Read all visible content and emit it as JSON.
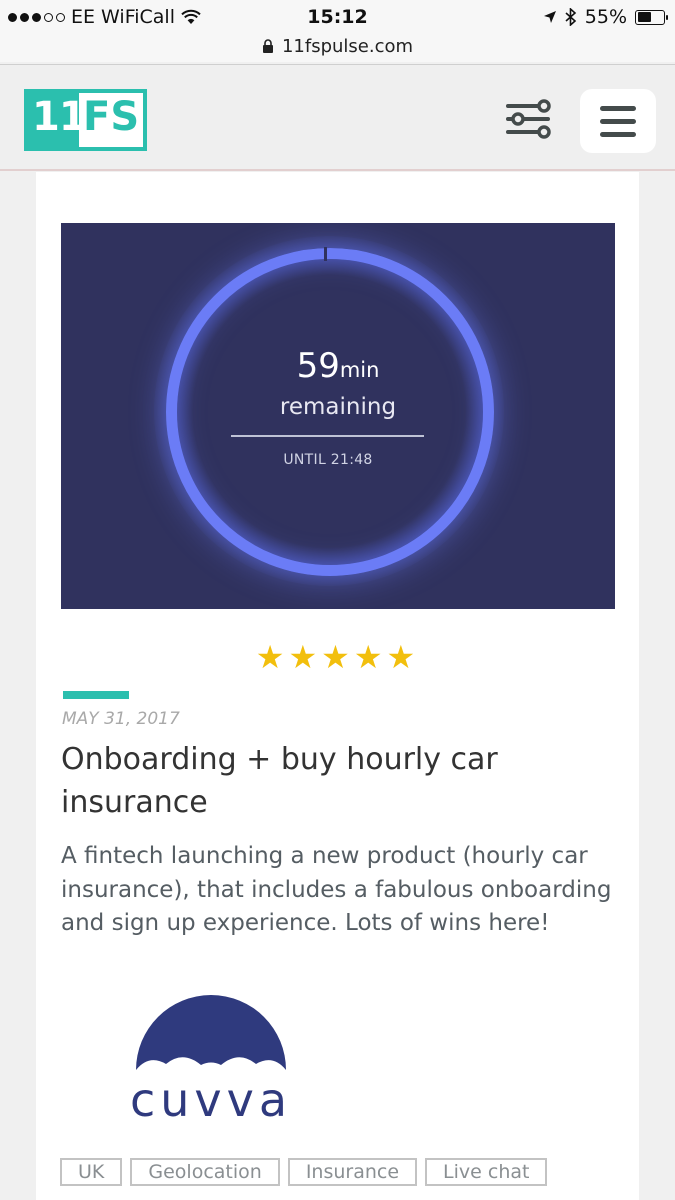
{
  "status_bar": {
    "carrier": "EE WiFiCall",
    "time": "15:12",
    "battery_percent": "55%",
    "battery_level": 0.55
  },
  "browser": {
    "url": "11fspulse.com"
  },
  "header": {
    "logo_number": "11",
    "logo_letters": "FS",
    "brand_color": "#2bbfae",
    "filter_icon": "sliders-icon",
    "menu_icon": "hamburger-menu-icon"
  },
  "article": {
    "hero": {
      "minutes": "59",
      "minutes_unit": "min",
      "remaining_label": "remaining",
      "until_label": "UNTIL 21:48",
      "background_color": "#30325e",
      "ring_color": "#6b7cf6"
    },
    "rating": {
      "stars": 5,
      "max": 5,
      "display": "★★★★★",
      "color": "#f2bf0d"
    },
    "date": "MAY 31, 2017",
    "title": "Onboarding + buy hourly car insurance",
    "description": "A fintech launching a new product (hourly car insurance), that includes a fabulous onboarding and sign up experience. Lots of wins here!",
    "company_logo": {
      "wordmark": "cuvva",
      "color": "#2f3a7e"
    },
    "tags": [
      {
        "label": "UK"
      },
      {
        "label": "Geolocation"
      },
      {
        "label": "Insurance"
      },
      {
        "label": "Live chat"
      }
    ]
  }
}
